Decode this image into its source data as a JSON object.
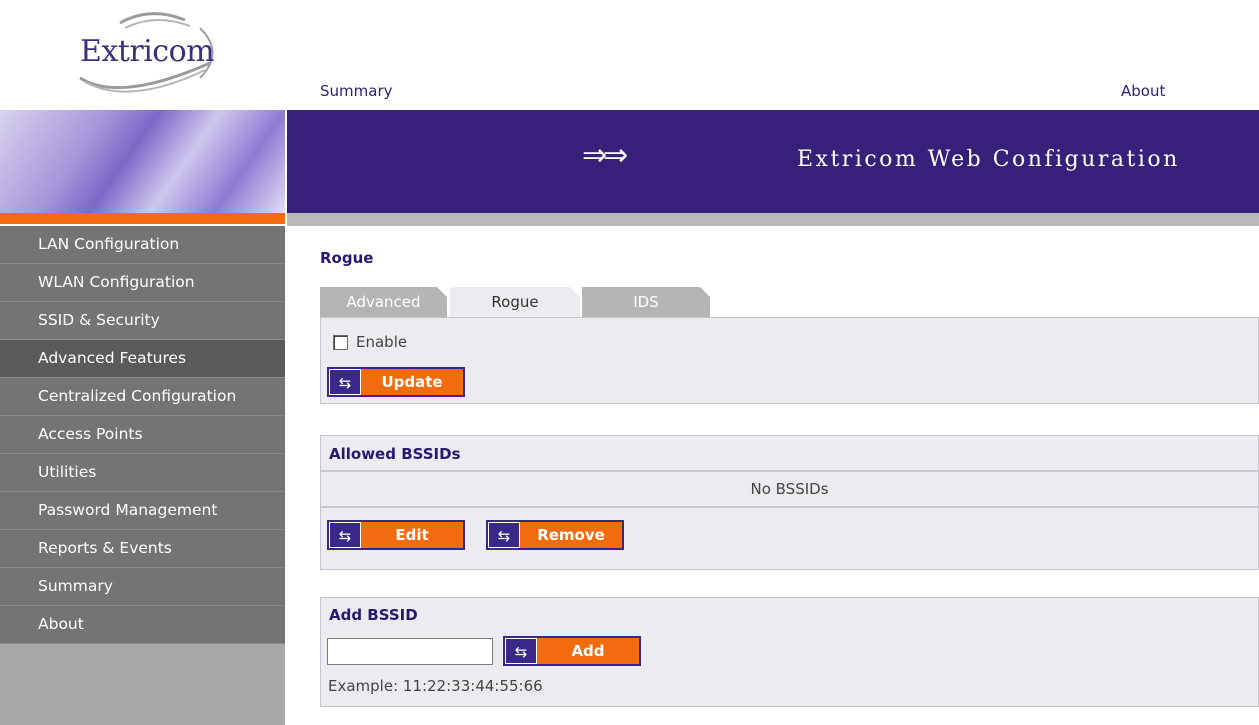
{
  "header": {
    "logo_text": "Extricom",
    "top_links": {
      "summary": "Summary",
      "about": "About"
    },
    "banner_arrows": "⇒⇒",
    "banner_title": "Extricom Web Configuration"
  },
  "sidebar": {
    "items": [
      {
        "label": "LAN Configuration"
      },
      {
        "label": "WLAN Configuration"
      },
      {
        "label": "SSID & Security"
      },
      {
        "label": "Advanced Features"
      },
      {
        "label": "Centralized Configuration"
      },
      {
        "label": "Access Points"
      },
      {
        "label": "Utilities"
      },
      {
        "label": "Password Management"
      },
      {
        "label": "Reports & Events"
      },
      {
        "label": "Summary"
      },
      {
        "label": "About"
      }
    ]
  },
  "main": {
    "page_title": "Rogue",
    "tabs": [
      {
        "label": "Advanced"
      },
      {
        "label": "Rogue"
      },
      {
        "label": "IDS"
      }
    ],
    "rogue_panel": {
      "enable_label": "Enable",
      "enable_checked": false,
      "update_label": "Update"
    },
    "allowed": {
      "title": "Allowed BSSIDs",
      "empty_text": "No BSSIDs",
      "edit_label": "Edit",
      "remove_label": "Remove"
    },
    "add": {
      "title": "Add BSSID",
      "input_value": "",
      "add_label": "Add",
      "example_text": "Example: 11:22:33:44:55:66"
    },
    "button_icon_glyph": "⇆"
  },
  "colors": {
    "banner": "#37207a",
    "accent_orange": "#f26b0f",
    "sidebar_item": "#747474",
    "sidebar_active": "#5a5a5a",
    "panel_bg": "#ecebf0"
  }
}
